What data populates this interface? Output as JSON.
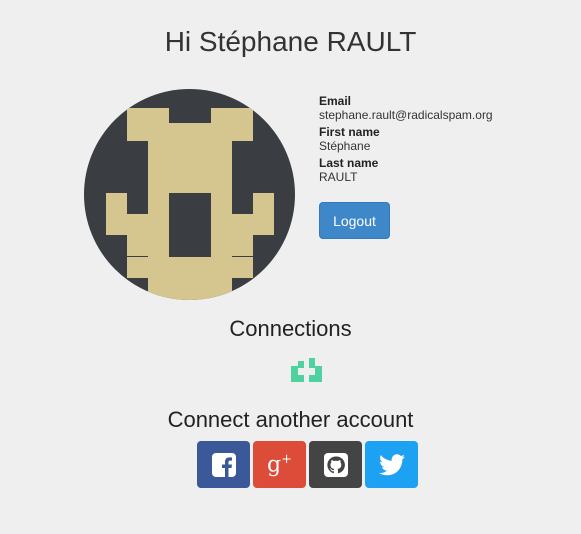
{
  "greeting": "Hi Stéphane RAULT",
  "profile": {
    "email_label": "Email",
    "email_value": "stephane.rault@radicalspam.org",
    "first_name_label": "First name",
    "first_name_value": "Stéphane",
    "last_name_label": "Last name",
    "last_name_value": "RAULT"
  },
  "logout_label": "Logout",
  "connections_title": "Connections",
  "connections": [
    {
      "icon": "connected-account-icon",
      "color": "#4fd1a0"
    }
  ],
  "connect_another_title": "Connect another account",
  "social_buttons": [
    {
      "icon": "facebook-icon",
      "color": "#3b5998"
    },
    {
      "icon": "google-plus-icon",
      "color": "#dd4b39",
      "glyph": "g",
      "plus": "+"
    },
    {
      "icon": "github-icon",
      "color": "#444444"
    },
    {
      "icon": "twitter-icon",
      "color": "#1da1f2"
    }
  ],
  "colors": {
    "background": "#efefef",
    "logout": "#3e87c8",
    "avatar_dark": "#3a3d41",
    "avatar_light": "#d4c68e"
  }
}
